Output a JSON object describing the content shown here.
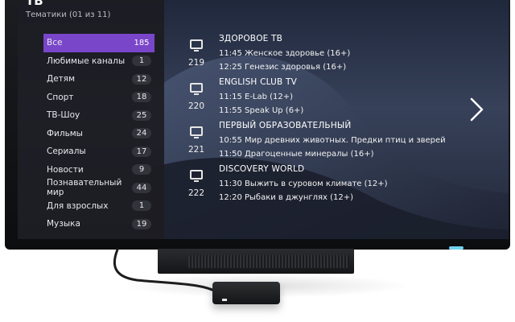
{
  "sidebar": {
    "title": "ТВ",
    "subtitle": "Тематики (01 из 11)",
    "items": [
      {
        "label": "Все",
        "count": "185",
        "active": true
      },
      {
        "label": "Любимые каналы",
        "count": "1"
      },
      {
        "label": "Детям",
        "count": "12"
      },
      {
        "label": "Спорт",
        "count": "18"
      },
      {
        "label": "ТВ-Шоу",
        "count": "25"
      },
      {
        "label": "Фильмы",
        "count": "24"
      },
      {
        "label": "Сериалы",
        "count": "17"
      },
      {
        "label": "Новости",
        "count": "9"
      },
      {
        "label": "Познавательный мир",
        "count": "44"
      },
      {
        "label": "Для взрослых",
        "count": "1"
      },
      {
        "label": "Музыка",
        "count": "19"
      }
    ]
  },
  "guide": {
    "channels": [
      {
        "number": "219",
        "name": "ЗДОРОВОЕ ТВ",
        "programs": [
          "11:45  Женское здоровье (16+)",
          "12:25  Генезис здоровья (16+)"
        ]
      },
      {
        "number": "220",
        "name": "ENGLISH CLUB TV",
        "programs": [
          "11:15  E-Lab (12+)",
          "11:55  Speak Up (6+)"
        ]
      },
      {
        "number": "221",
        "name": "ПЕРВЫЙ ОБРАЗОВАТЕЛЬНЫЙ",
        "programs": [
          "10:55  Мир древних животных. Предки птиц и зверей",
          "11:50  Драгоценные минералы (16+)"
        ]
      },
      {
        "number": "222",
        "name": "DISCOVERY WORLD",
        "programs": [
          "11:30  Выжить в суровом климате (12+)",
          "12:20  Рыбаки в джунглях (12+)"
        ]
      }
    ]
  },
  "icons": {
    "tv": "tv-icon",
    "next": "chevron-right-icon"
  },
  "colors": {
    "accent": "#7a46c9",
    "led": "#6fd3ee"
  }
}
